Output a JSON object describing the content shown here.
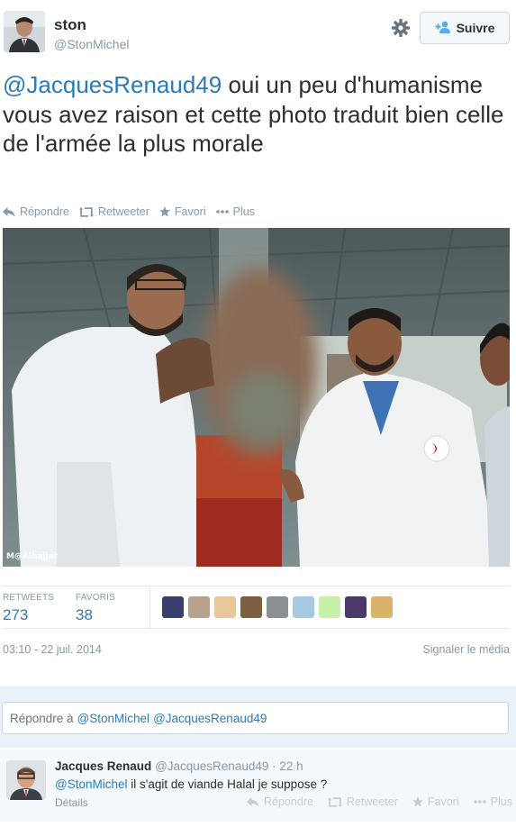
{
  "tweet": {
    "display_name": "ston",
    "screen_name": "@StonMichel",
    "follow_label": "Suivre",
    "mention": "@JacquesRenaud49",
    "text_rest": " oui un peu d'humanisme vous avez raison et cette photo traduit bien celle de l'armée la plus morale",
    "actions": {
      "reply": "Répondre",
      "retweet": "Retweeter",
      "favorite": "Favori",
      "more": "Plus"
    },
    "media_watermark": "M@Alhajjar",
    "stats": {
      "retweets_label": "RETWEETS",
      "retweets_count": "273",
      "favorites_label": "FAVORIS",
      "favorites_count": "38"
    },
    "favoriter_avatar_colors": [
      "#3b3f6e",
      "#b9a28d",
      "#e8c89a",
      "#7d5f42",
      "#8a8f94",
      "#a7c7e3",
      "#c8f0a8",
      "#4a3a6a",
      "#d9b36a"
    ],
    "timestamp": "03:10 - 22 juil. 2014",
    "report_media": "Signaler le média"
  },
  "reply_composer": {
    "prefix": "Répondre à",
    "mention_1": "@StonMichel",
    "mention_2": "@JacquesRenaud49"
  },
  "reply_tweet": {
    "display_name": "Jacques Renaud",
    "screen_name": "@JacquesRenaud49",
    "time": "· 22 h",
    "mention": "@StonMichel",
    "text_rest": " il s'agit de viande Halal je suppose ?",
    "details": "Détails",
    "actions": {
      "reply": "Répondre",
      "retweet": "Retweeter",
      "favorite": "Favori",
      "more": "Plus"
    }
  },
  "colors": {
    "link_blue": "#2b7bb9",
    "muted_gray": "#8899a6",
    "reply_area_bg": "#e8f2f8"
  }
}
